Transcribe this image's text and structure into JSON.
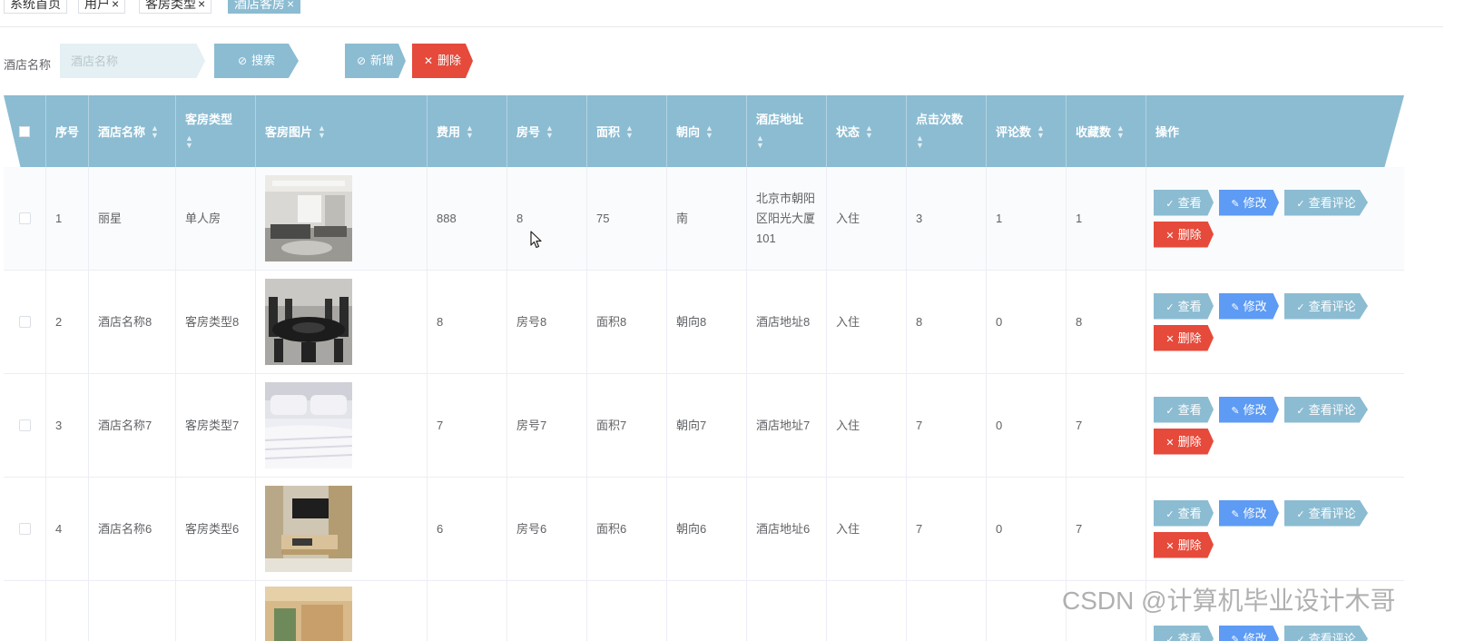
{
  "tabs": [
    {
      "label": "系统首页",
      "closable": false,
      "active": false
    },
    {
      "label": "用户",
      "closable": true,
      "active": false
    },
    {
      "label": "客房类型",
      "closable": true,
      "active": false
    },
    {
      "label": "酒店客房",
      "closable": true,
      "active": true
    }
  ],
  "close_glyph": "×",
  "search": {
    "label": "酒店名称",
    "placeholder": "酒店名称",
    "value": "",
    "search_button": "搜索",
    "add_button": "新增",
    "delete_button": "删除"
  },
  "table": {
    "columns": [
      "序号",
      "酒店名称",
      "客房类型",
      "客房图片",
      "费用",
      "房号",
      "面积",
      "朝向",
      "酒店地址",
      "状态",
      "点击次数",
      "评论数",
      "收藏数",
      "操作"
    ],
    "actions": {
      "view": "查看",
      "edit": "修改",
      "comment": "查看评论",
      "delete": "删除"
    },
    "rows": [
      {
        "index": "1",
        "hotel": "丽星",
        "type": "单人房",
        "image": "living-room-photo",
        "fee": "888",
        "room": "8",
        "area": "75",
        "facing": "南",
        "address": "北京市朝阳区阳光大厦101",
        "status": "入住",
        "clicks": "3",
        "comments": "1",
        "favorites": "1"
      },
      {
        "index": "2",
        "hotel": "酒店名称8",
        "type": "客房类型8",
        "image": "dining-room-photo",
        "fee": "8",
        "room": "房号8",
        "area": "面积8",
        "facing": "朝向8",
        "address": "酒店地址8",
        "status": "入住",
        "clicks": "8",
        "comments": "0",
        "favorites": "8"
      },
      {
        "index": "3",
        "hotel": "酒店名称7",
        "type": "客房类型7",
        "image": "bed-linen-photo",
        "fee": "7",
        "room": "房号7",
        "area": "面积7",
        "facing": "朝向7",
        "address": "酒店地址7",
        "status": "入住",
        "clicks": "7",
        "comments": "0",
        "favorites": "7"
      },
      {
        "index": "4",
        "hotel": "酒店名称6",
        "type": "客房类型6",
        "image": "tv-room-photo",
        "fee": "6",
        "room": "房号6",
        "area": "面积6",
        "facing": "朝向6",
        "address": "酒店地址6",
        "status": "入住",
        "clicks": "7",
        "comments": "0",
        "favorites": "7"
      }
    ]
  },
  "watermark": "CSDN @计算机毕业设计木哥",
  "colors": {
    "primary": "#8bbcd2",
    "danger": "#e64a3b",
    "edit": "#5d9bf4"
  }
}
